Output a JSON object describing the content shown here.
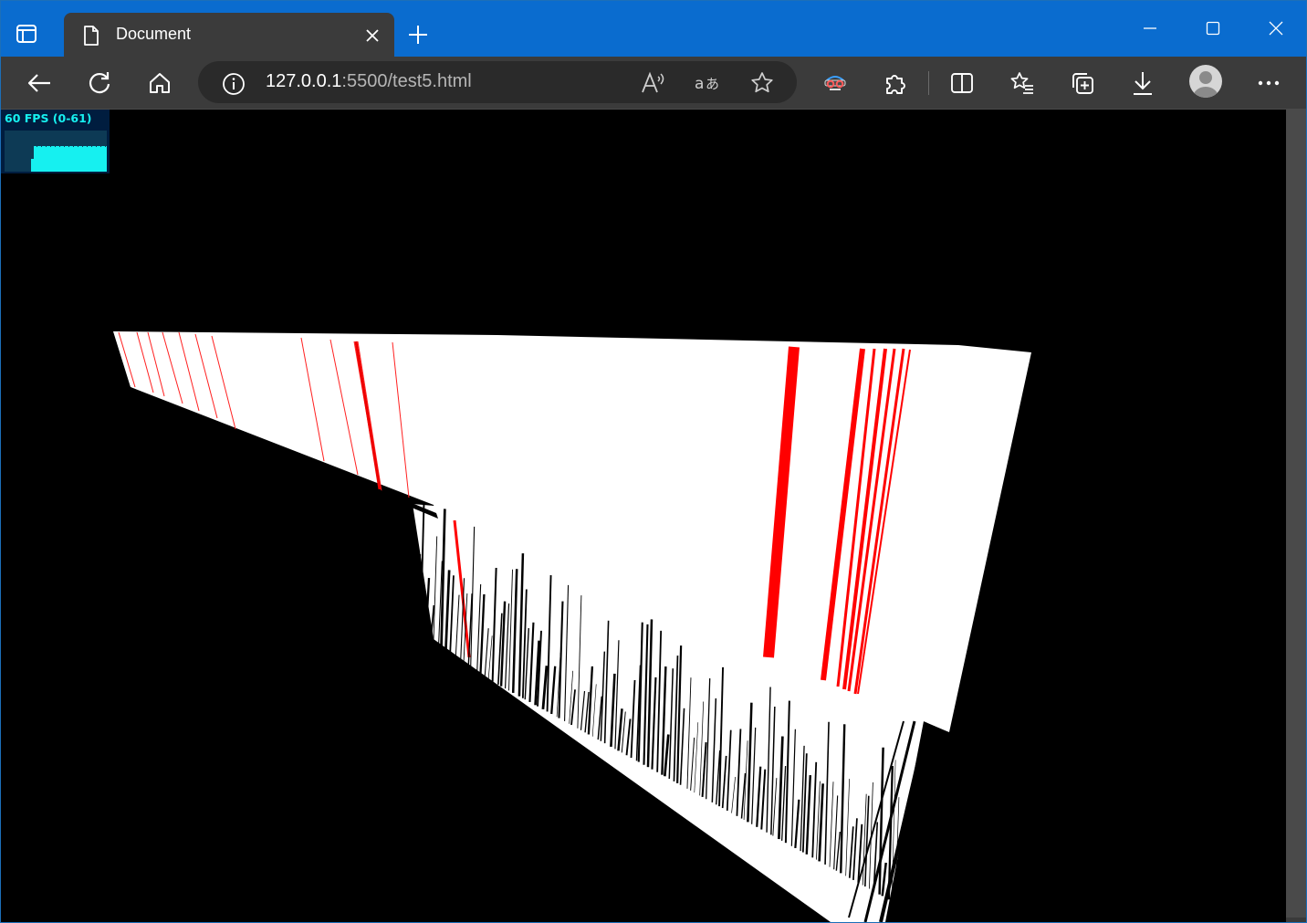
{
  "window": {
    "tab_title": "Document",
    "colors": {
      "titlebar": "#0a6ccf",
      "toolbar": "#3b3b3b",
      "accent_fps": "#16f0f0"
    }
  },
  "toolbar": {
    "url_host": "127.0.0.1",
    "url_rest": ":5500/test5.html",
    "icons": [
      "back-arrow-icon",
      "refresh-icon",
      "home-icon",
      "info-icon",
      "read-aloud-icon",
      "translate-icon",
      "favorite-star-icon",
      "browser-essentials-icon",
      "extensions-icon",
      "split-screen-icon",
      "favorites-icon",
      "collections-icon",
      "download-icon",
      "profile-avatar",
      "more-icon"
    ]
  },
  "fps_meter": {
    "label": "60 FPS (0-61)",
    "current_fps": 60,
    "min_fps": 0,
    "max_fps": 61
  }
}
